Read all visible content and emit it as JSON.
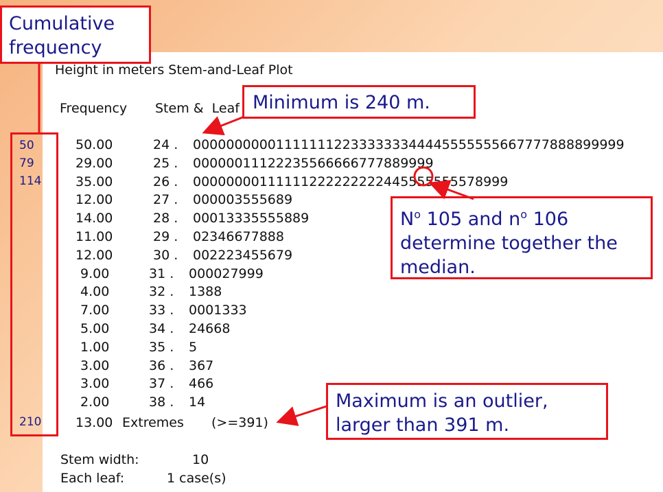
{
  "title": "Height in meters Stem-and-Leaf Plot",
  "header": {
    "frequency": "Frequency",
    "stem_leaf": "Stem &  Leaf"
  },
  "rows": [
    {
      "freq": "50.00",
      "stem": "24 .",
      "leaf": "0000000000111111122333333344445555555667777888899999"
    },
    {
      "freq": "29.00",
      "stem": "25 .",
      "leaf": "00000011122235566666777889999"
    },
    {
      "freq": "35.00",
      "stem": "26 .",
      "leaf": "00000000111111222222222445555555578999"
    },
    {
      "freq": "12.00",
      "stem": "27 .",
      "leaf": "000003555689"
    },
    {
      "freq": "14.00",
      "stem": "28 .",
      "leaf": "00013335555889"
    },
    {
      "freq": "11.00",
      "stem": "29 .",
      "leaf": "02346677888"
    },
    {
      "freq": "12.00",
      "stem": "30 .",
      "leaf": "002223455679"
    },
    {
      "freq": "9.00",
      "stem": "31 .",
      "leaf": "000027999"
    },
    {
      "freq": "4.00",
      "stem": "32 .",
      "leaf": "1388"
    },
    {
      "freq": "7.00",
      "stem": "33 .",
      "leaf": "0001333"
    },
    {
      "freq": "5.00",
      "stem": "34 .",
      "leaf": "24668"
    },
    {
      "freq": "1.00",
      "stem": "35 .",
      "leaf": "5"
    },
    {
      "freq": "3.00",
      "stem": "36 .",
      "leaf": "367"
    },
    {
      "freq": "3.00",
      "stem": "37 .",
      "leaf": "466"
    },
    {
      "freq": "2.00",
      "stem": "38 .",
      "leaf": "14"
    }
  ],
  "extremes": {
    "freq": "13.00",
    "label": "Extremes",
    "cond": "(>=391)"
  },
  "footer": {
    "stem_width_label": "Stem width:",
    "stem_width_value": "10",
    "each_leaf_label": "Each leaf:",
    "each_leaf_value": "1 case(s)"
  },
  "callouts": {
    "cumulative": [
      "Cumulative",
      "frequency"
    ],
    "minimum": "Minimum is 240 m.",
    "median_line1_no": "N",
    "median_line1_sup": "o",
    "median_line1_mid": " 105 and n",
    "median_line1_sup2": "o",
    "median_line1_end": " 106",
    "median_line2": "determine together the",
    "median_line3": "median.",
    "maximum": [
      "Maximum is an outlier,",
      "larger than 391 m."
    ]
  },
  "cumulative_values": [
    "50",
    "79",
    "114",
    "210"
  ],
  "colors": {
    "accent_red": "#e8141b",
    "text_navy": "#1a1a8c"
  }
}
